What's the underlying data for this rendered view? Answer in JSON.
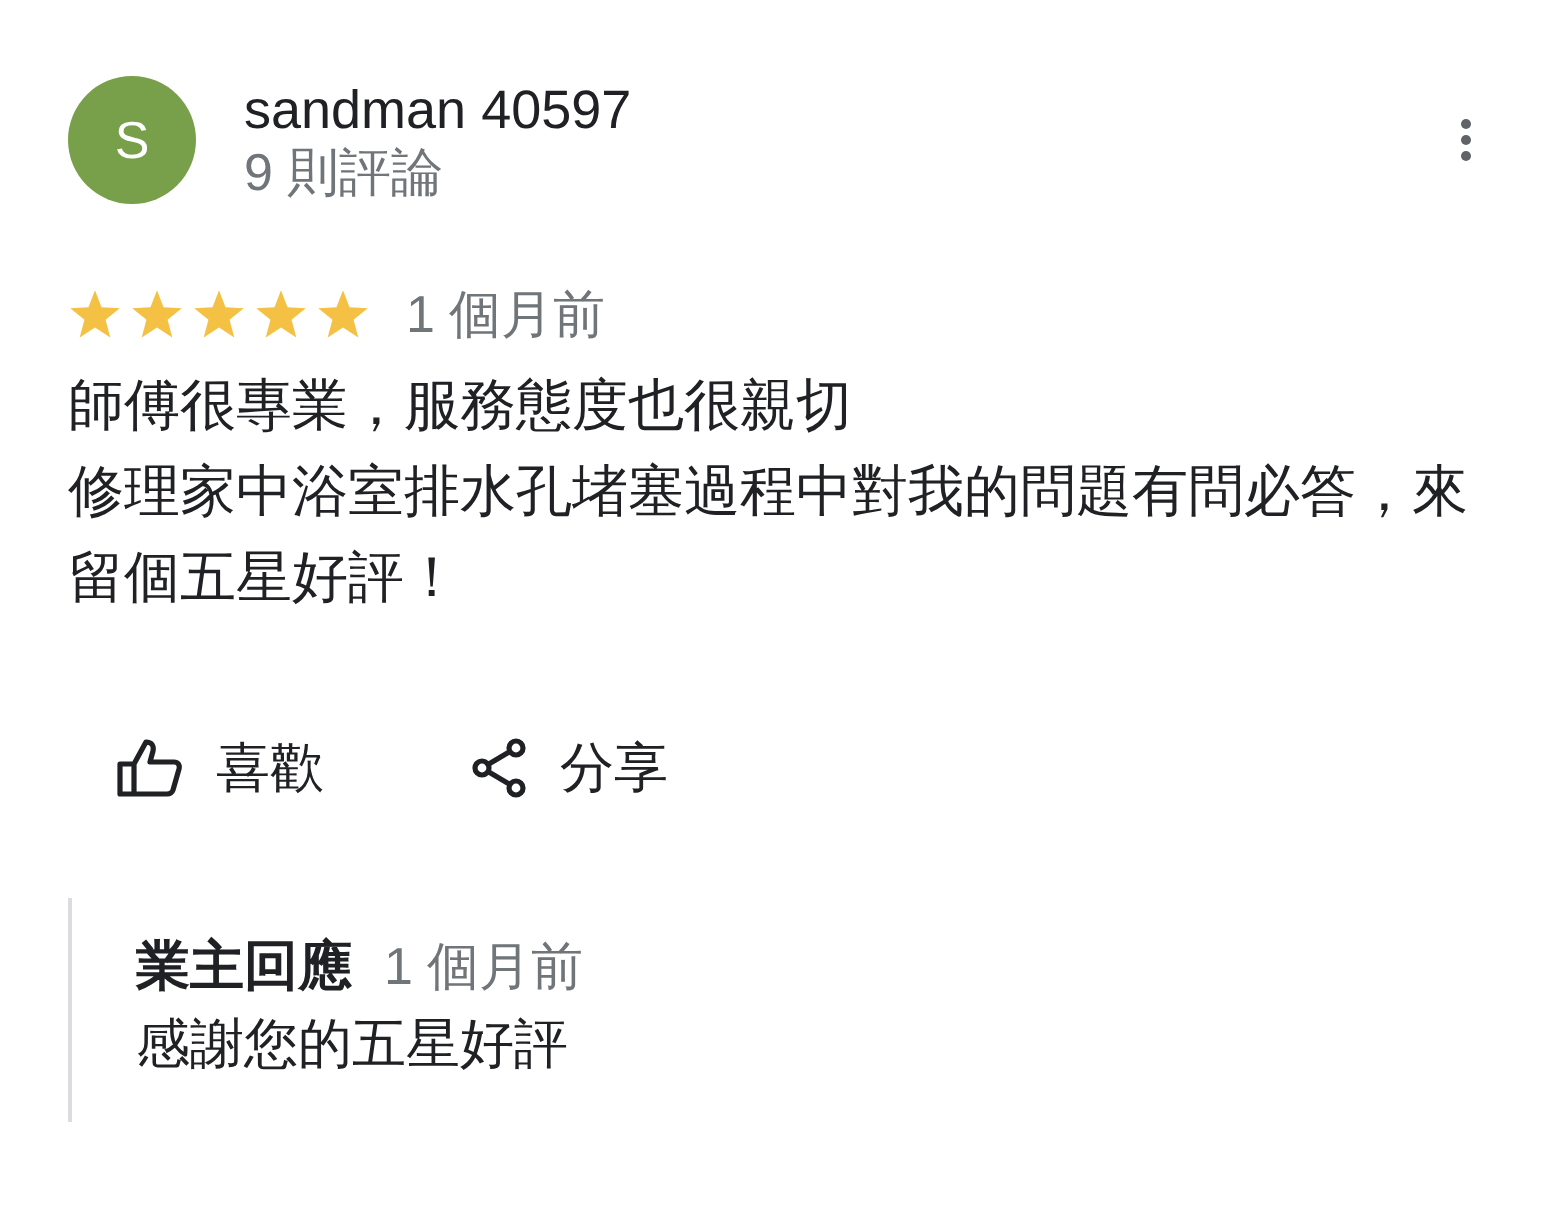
{
  "reviewer": {
    "avatar_letter": "S",
    "name": "sandman 40597",
    "review_count": "9 則評論"
  },
  "rating": {
    "stars": 5,
    "time": "1 個月前"
  },
  "body": [
    "師傅很專業，服務態度也很親切",
    "修理家中浴室排水孔堵塞過程中對我的問題有問必答，來留個五星好評！"
  ],
  "actions": [
    {
      "kind": "like",
      "label": "喜歡"
    },
    {
      "kind": "share",
      "label": "分享"
    }
  ],
  "owner_reply": {
    "title": "業主回應",
    "time": "1 個月前",
    "text": "感謝您的五星好評"
  }
}
